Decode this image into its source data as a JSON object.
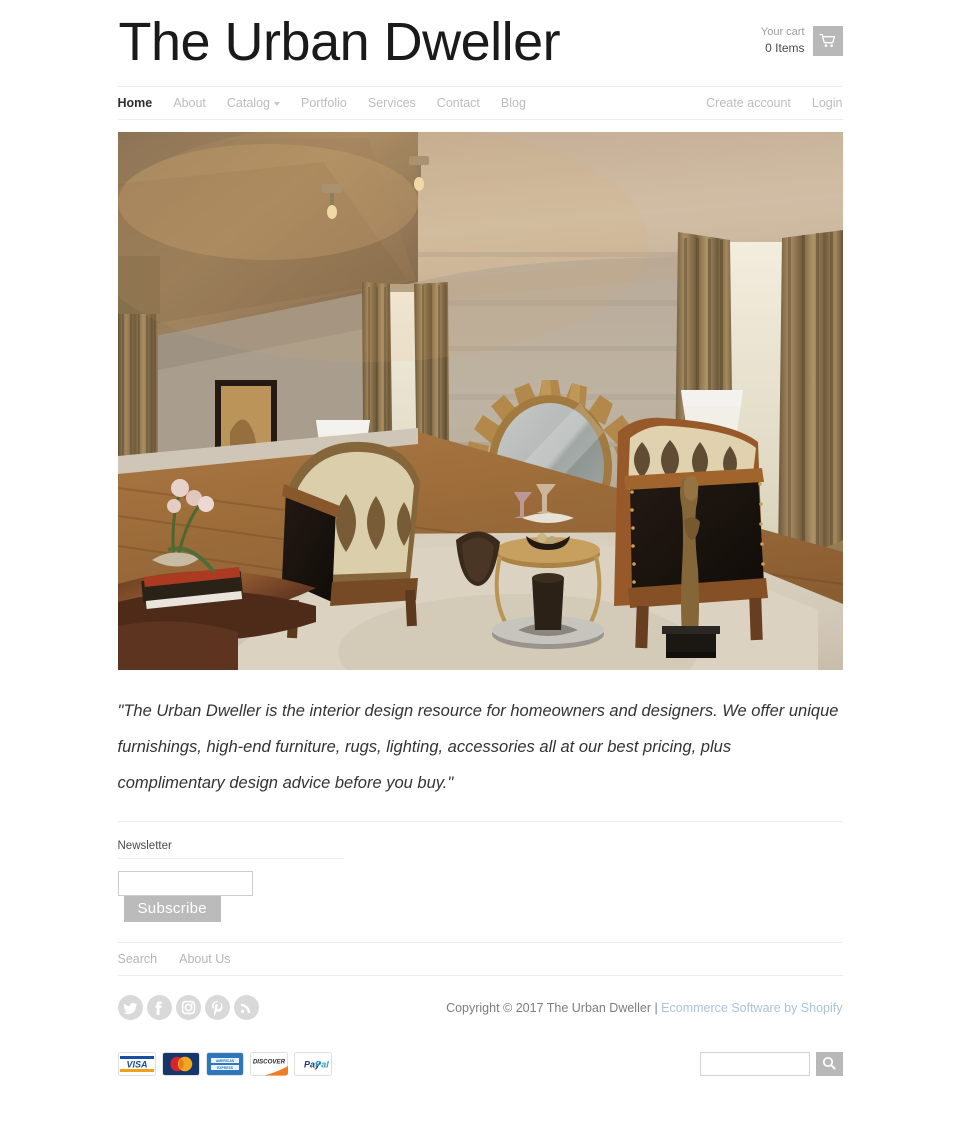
{
  "header": {
    "site_title": "The Urban Dweller",
    "cart_label": "Your cart",
    "cart_count": "0 Items",
    "cart_icon": "shopping-cart-icon"
  },
  "nav": {
    "primary": [
      {
        "label": "Home",
        "active": true,
        "caret": false
      },
      {
        "label": "About",
        "active": false,
        "caret": false
      },
      {
        "label": "Catalog",
        "active": false,
        "caret": true
      },
      {
        "label": "Portfolio",
        "active": false,
        "caret": false
      },
      {
        "label": "Services",
        "active": false,
        "caret": false
      },
      {
        "label": "Contact",
        "active": false,
        "caret": false
      },
      {
        "label": "Blog",
        "active": false,
        "caret": false
      }
    ],
    "secondary": [
      {
        "label": "Create account"
      },
      {
        "label": "Login"
      }
    ]
  },
  "hero": {
    "alt": "Interior of a living room with sunburst mirror, fireplace, two upholstered armchairs, gold drapery and a cream area rug"
  },
  "quote": {
    "text": "\"The Urban Dweller is the interior design resource for homeowners and designers.  We offer unique furnishings, high-end furniture, rugs, lighting, accessories all at our best pricing, plus complimentary design advice before you buy.\""
  },
  "newsletter": {
    "title": "Newsletter",
    "input_value": "",
    "input_placeholder": "",
    "button_label": "Subscribe"
  },
  "footer": {
    "links": [
      {
        "label": "Search"
      },
      {
        "label": "About Us"
      }
    ],
    "social": [
      {
        "name": "twitter-icon"
      },
      {
        "name": "facebook-icon"
      },
      {
        "name": "instagram-icon"
      },
      {
        "name": "pinterest-icon"
      },
      {
        "name": "rss-icon"
      }
    ],
    "copyright_text": "Copyright © 2017 The Urban Dweller | ",
    "copyright_link": "Ecommerce Software by Shopify",
    "payment_methods": [
      {
        "name": "visa-icon",
        "label": "VISA"
      },
      {
        "name": "mastercard-icon",
        "label": ""
      },
      {
        "name": "american-express-icon",
        "label": "AMERICAN EXPRESS"
      },
      {
        "name": "discover-icon",
        "label": "DISCOVER"
      },
      {
        "name": "paypal-icon",
        "label": "PayPal"
      }
    ],
    "search_value": "",
    "search_placeholder": "",
    "search_icon": "search-icon"
  },
  "colors": {
    "accent_gray": "#b8b8b8",
    "link_blue": "#a9c4d6",
    "text_dark": "#1a1a1a",
    "text_muted": "#bdbdbd",
    "border": "#ececec"
  }
}
